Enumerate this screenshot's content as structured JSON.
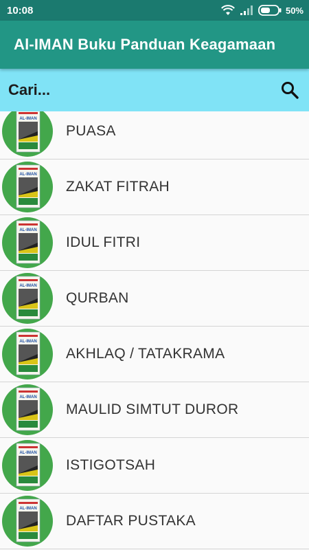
{
  "status_bar": {
    "time": "10:08",
    "battery_percent": "50%",
    "icons": [
      "wifi-icon",
      "signal-icon",
      "battery-icon"
    ]
  },
  "app_bar": {
    "title": "Al-IMAN Buku Panduan Keagamaan"
  },
  "search": {
    "placeholder": "Cari...",
    "value": ""
  },
  "list": {
    "items": [
      {
        "label": "PUASA",
        "thumb_text": "AL-IMAN"
      },
      {
        "label": "ZAKAT FITRAH",
        "thumb_text": "AL-IMAN"
      },
      {
        "label": "IDUL FITRI",
        "thumb_text": "AL-IMAN"
      },
      {
        "label": "QURBAN",
        "thumb_text": "AL-IMAN"
      },
      {
        "label": "AKHLAQ / TATAKRAMA",
        "thumb_text": "AL-IMAN"
      },
      {
        "label": "MAULID SIMTUT DUROR",
        "thumb_text": "AL-IMAN"
      },
      {
        "label": "ISTIGOTSAH",
        "thumb_text": "AL-IMAN"
      },
      {
        "label": "DAFTAR PUSTAKA",
        "thumb_text": "AL-IMAN"
      }
    ]
  },
  "colors": {
    "status_bar": "#1b7a6f",
    "app_bar": "#229685",
    "search_bar": "#80e3f6",
    "thumb_circle": "#43a74b"
  }
}
